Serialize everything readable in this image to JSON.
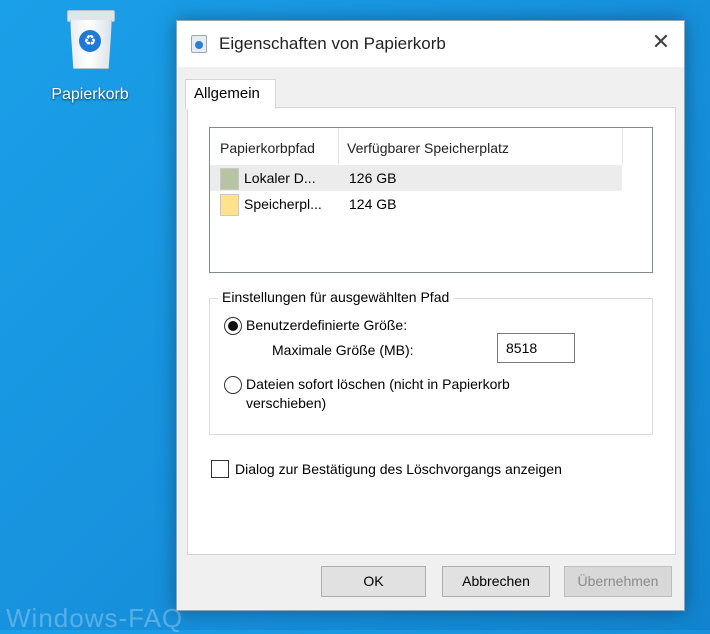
{
  "desktop": {
    "recycle_bin_label": "Papierkorb",
    "watermark": "Windows-FAQ"
  },
  "dialog": {
    "title": "Eigenschaften von Papierkorb",
    "close_glyph": "✕",
    "tab_label": "Allgemein",
    "list": {
      "columns": [
        "Papierkorbpfad",
        "Verfügbarer Speicherplatz"
      ],
      "rows": [
        {
          "path": "Lokaler D...",
          "space": "126 GB",
          "icon_color": "#b7c4a2",
          "selected": true
        },
        {
          "path": "Speicherpl...",
          "space": "124 GB",
          "icon_color": "#ffe38a",
          "selected": false
        }
      ]
    },
    "settings": {
      "group_title": "Einstellungen für ausgewählten Pfad",
      "custom_size_label": "Benutzerdefinierte Größe:",
      "custom_size_checked": true,
      "max_size_label": "Maximale Größe (MB):",
      "max_size_value": "8518",
      "delete_immediately_label_line1": "Dateien sofort löschen (nicht in Papierkorb",
      "delete_immediately_label_line2": "verschieben)",
      "delete_immediately_checked": false
    },
    "confirm_dialog_label": "Dialog zur Bestätigung des Löschvorgangs anzeigen",
    "confirm_dialog_checked": false,
    "buttons": {
      "ok": "OK",
      "cancel": "Abbrechen",
      "apply": "Übernehmen"
    }
  }
}
